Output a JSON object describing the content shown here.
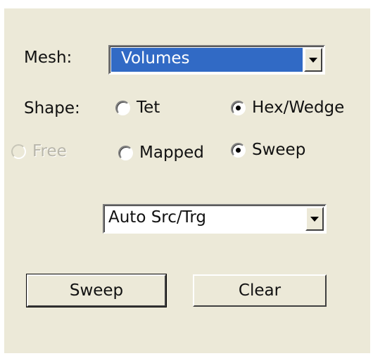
{
  "mesh": {
    "label": "Mesh:",
    "value": "Volumes"
  },
  "shape": {
    "label": "Shape:",
    "options": [
      {
        "label": "Tet",
        "checked": false
      },
      {
        "label": "Hex/Wedge",
        "checked": true
      }
    ]
  },
  "scheme": {
    "options": [
      {
        "label": "Free",
        "checked": false,
        "enabled": false
      },
      {
        "label": "Mapped",
        "checked": false,
        "enabled": true
      },
      {
        "label": "Sweep",
        "checked": true,
        "enabled": true
      }
    ]
  },
  "source_target": {
    "value": "Auto Src/Trg"
  },
  "buttons": {
    "sweep_label": "Sweep",
    "clear_label": "Clear"
  },
  "colors": {
    "panel_background": "#ece9d8",
    "selection_highlight": "#316ac5"
  }
}
